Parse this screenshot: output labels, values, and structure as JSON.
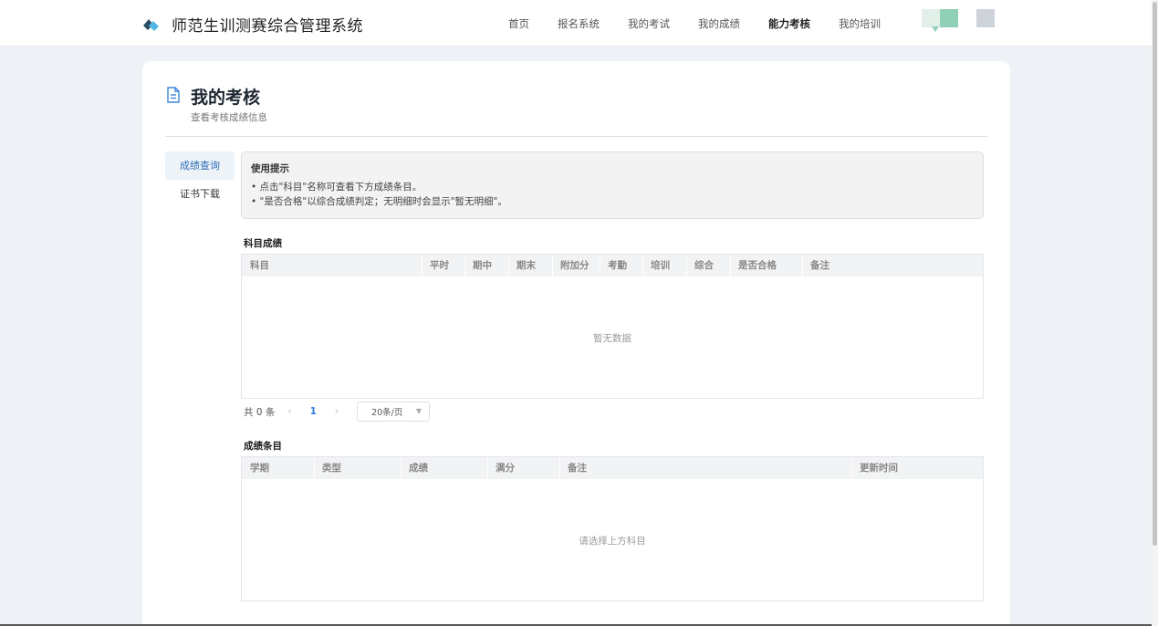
{
  "header": {
    "app_title": "师范生训测赛综合管理系统",
    "nav": [
      {
        "label": "首页",
        "active": false
      },
      {
        "label": "报名系统",
        "active": false
      },
      {
        "label": "我的考试",
        "active": false
      },
      {
        "label": "我的成绩",
        "active": false
      },
      {
        "label": "能力考核",
        "active": true
      },
      {
        "label": "我的培训",
        "active": false
      }
    ]
  },
  "page": {
    "title": "我的考核",
    "subtitle": "查看考核成绩信息"
  },
  "sidebar": {
    "tabs": [
      {
        "label": "成绩查询",
        "active": true
      },
      {
        "label": "证书下载",
        "active": false
      }
    ]
  },
  "tips": {
    "title": "使用提示",
    "lines": [
      "• 点击\"科目\"名称可查看下方成绩条目。",
      "• \"是否合格\"以综合成绩判定；无明细时会显示\"暂无明细\"。"
    ]
  },
  "subjects_table": {
    "title": "科目成绩",
    "columns": [
      "科目",
      "平时",
      "期中",
      "期末",
      "附加分",
      "考勤",
      "培训",
      "综合",
      "是否合格",
      "备注"
    ],
    "rows": [],
    "empty_text": "暂无数据"
  },
  "pagination": {
    "total_text": "共 0 条",
    "prev_symbol": "‹",
    "current_page": "1",
    "next_symbol": "›",
    "page_size": "20条/页"
  },
  "items_table": {
    "title": "成绩条目",
    "columns": [
      "学期",
      "类型",
      "成绩",
      "满分",
      "备注",
      "更新时间"
    ],
    "rows": [],
    "empty_text": "请选择上方科目"
  },
  "colors": {
    "accent": "#2f7be0",
    "active_tab_bg": "#eef3f8",
    "page_bg": "#eef2f6"
  }
}
